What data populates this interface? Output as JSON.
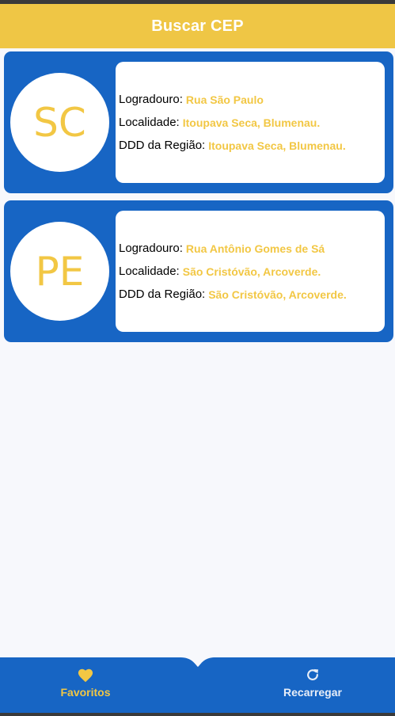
{
  "app_bar": {
    "title": "Buscar CEP"
  },
  "cards": [
    {
      "avatar": "SC",
      "logradouro_label": "Logradouro:",
      "logradouro_value": "Rua São Paulo",
      "localidade_label": "Localidade:",
      "localidade_value": "Itoupava Seca, Blumenau.",
      "ddd_label": "DDD da Região:",
      "ddd_value": "Itoupava Seca, Blumenau."
    },
    {
      "avatar": "PE",
      "logradouro_label": "Logradouro:",
      "logradouro_value": "Rua Antônio Gomes de Sá",
      "localidade_label": "Localidade:",
      "localidade_value": "São Cristóvão, Arcoverde.",
      "ddd_label": "DDD da Região:",
      "ddd_value": "São Cristóvão, Arcoverde."
    }
  ],
  "bottom_nav": {
    "favoritos_label": "Favoritos",
    "favoritos_icon": "heart-icon",
    "recarregar_label": "Recarregar",
    "recarregar_icon": "refresh-icon",
    "active": "favoritos"
  },
  "colors": {
    "primary_blue": "#1765c4",
    "accent_yellow": "#efc645",
    "background": "#f7f8fc"
  }
}
